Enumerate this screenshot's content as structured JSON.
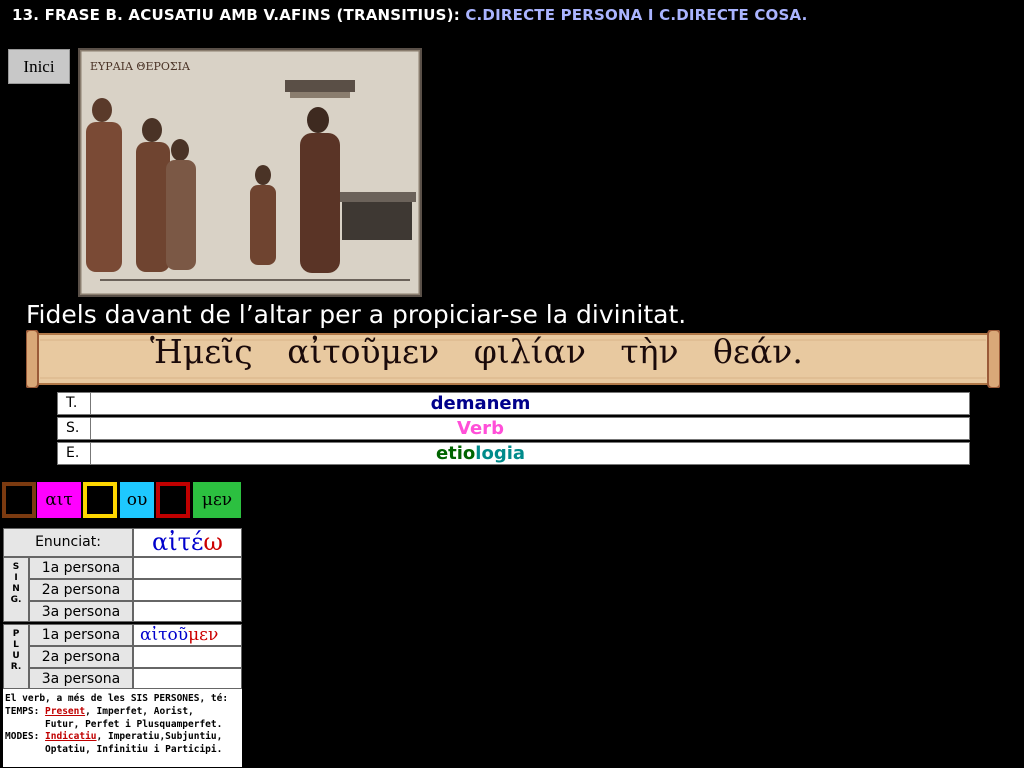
{
  "title": {
    "part1": "13. FRASE B. ACUSATIU AMB V.AFINS (TRANSITIUS): ",
    "part2": "C.DIRECTE PERSONA I C.DIRECTE COSA."
  },
  "nav": {
    "home_label": "Inici"
  },
  "caption": "Fidels davant de l’altar per a propiciar-se la divinitat.",
  "greek_sentence": "Ἡμεῖς αἰτοῦμεν φιλίαν τὴν θεάν.",
  "analysis": {
    "rows": [
      {
        "label": "T.",
        "value": "demanem",
        "color": "#00008b"
      },
      {
        "label": "S.",
        "value": "Verb",
        "color": "#ff4fd8"
      },
      {
        "label": "E.",
        "value_a": "etio",
        "value_b": "logia",
        "color_a": "#006400",
        "color_b": "#008b8b"
      }
    ]
  },
  "morph": {
    "segments": [
      {
        "kind": "blank",
        "border": "#7b3a10"
      },
      {
        "kind": "label",
        "text": "αιτ",
        "bg": "#ff00ff",
        "border": "#ff00ff"
      },
      {
        "kind": "blank",
        "border": "#ffd700"
      },
      {
        "kind": "label",
        "text": "ου",
        "bg": "#1ec8ff",
        "border": "#1ec8ff"
      },
      {
        "kind": "blank",
        "border": "#c00000"
      },
      {
        "kind": "label",
        "text": "μεν",
        "bg": "#2cc040",
        "border": "#2cc040"
      }
    ]
  },
  "conjugation": {
    "enunciat_label": "Enunciat:",
    "enunciat_value": "αἰτέω",
    "sing_label": [
      "S",
      "I",
      "N",
      "G."
    ],
    "plur_label": [
      "P",
      "L",
      "U",
      "R."
    ],
    "persons": [
      "1a persona",
      "2a persona",
      "3a persona"
    ],
    "plur_first_stem": "αἰτοῦ",
    "plur_first_ending": "μεν",
    "colors": {
      "stem": "#0000cc",
      "ending": "#cc0000"
    }
  },
  "notes": {
    "line1": "El verb, a més de les SIS PERSONES, té:",
    "temps_label": "TEMPS: ",
    "temps_highlight": "Present",
    "temps_rest": ", Imperfet, Aorist,",
    "temps_line2": "       Futur, Perfet i Plusquamperfet.",
    "modes_label": "MODES: ",
    "modes_highlight": "Indicatiu",
    "modes_rest": ", Imperatiu,Subjuntiu,",
    "modes_line2": "       Optatiu, Infinitiu i Participi."
  }
}
